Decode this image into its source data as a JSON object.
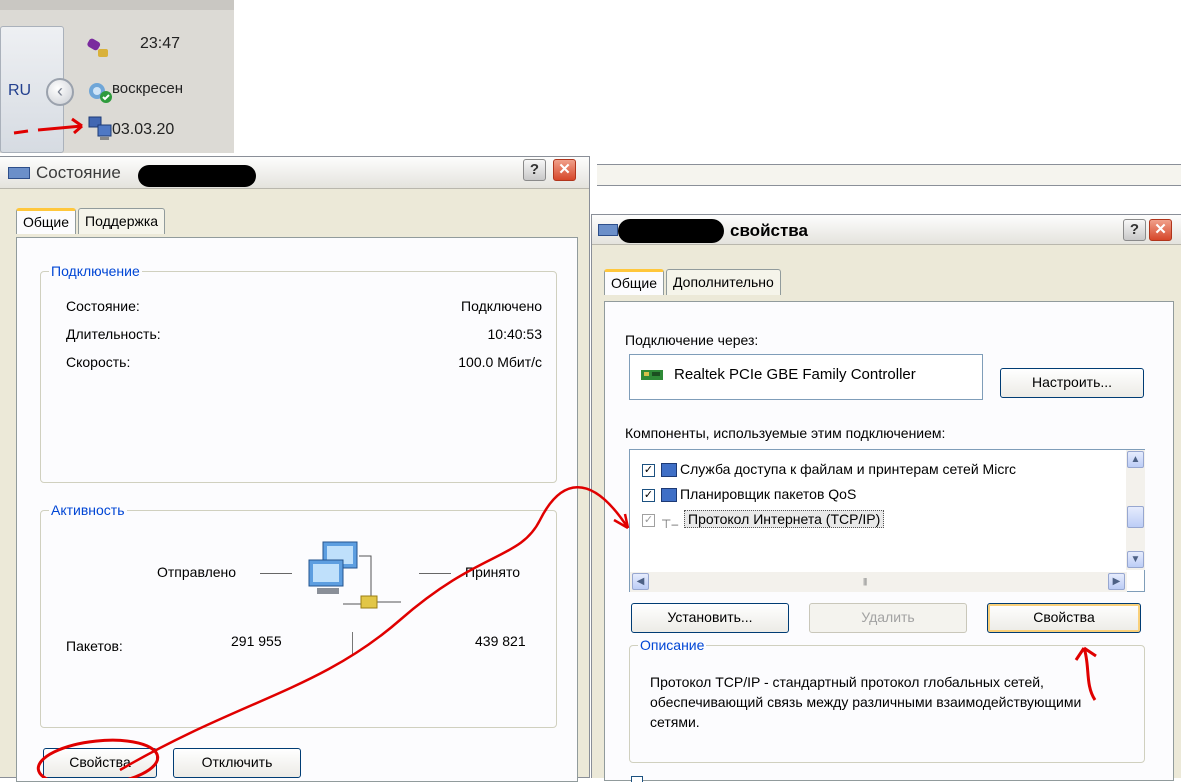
{
  "tray": {
    "time": "23:47",
    "day": "воскресен",
    "date": "03.03.20",
    "lang": "RU",
    "icons": [
      "power-tool-icon",
      "network-shield-icon",
      "network-connection-icon",
      "chevron-left-icon"
    ]
  },
  "status_window": {
    "title": "Состояние",
    "tabs": [
      "Общие",
      "Поддержка"
    ],
    "connection_group": {
      "legend": "Подключение",
      "rows": [
        {
          "label": "Состояние:",
          "value": "Подключено"
        },
        {
          "label": "Длительность:",
          "value": "10:40:53"
        },
        {
          "label": "Скорость:",
          "value": "100.0 Мбит/с"
        }
      ]
    },
    "activity_group": {
      "legend": "Активность",
      "sent_label": "Отправлено",
      "received_label": "Принято",
      "packets_label": "Пакетов:",
      "packets_sent": "291 955",
      "packets_received": "439 821"
    },
    "buttons": {
      "properties": "Свойства",
      "disable": "Отключить"
    }
  },
  "props_window": {
    "title": "свойства",
    "tabs": [
      "Общие",
      "Дополнительно"
    ],
    "connect_via_label": "Подключение через:",
    "adapter_name": "Realtek PCIe GBE Family Controller",
    "configure_button": "Настроить...",
    "components_label": "Компоненты, используемые этим подключением:",
    "components": [
      {
        "label": "Служба доступа к файлам и принтерам сетей Micrс",
        "checked": true,
        "selected": false,
        "icon": "network-service-icon"
      },
      {
        "label": "Планировщик пакетов QoS",
        "checked": true,
        "selected": false,
        "icon": "network-service-icon"
      },
      {
        "label": "Протокол Интернета (TCP/IP)",
        "checked": true,
        "selected": true,
        "icon": "protocol-icon"
      }
    ],
    "install_button": "Установить...",
    "remove_button": "Удалить",
    "properties_button": "Свойства",
    "description_legend": "Описание",
    "description_text": "Протокол TCP/IP - стандартный протокол глобальных сетей, обеспечивающий связь между различными взаимодействующими сетями.",
    "colors": {
      "accent": "#0046d5",
      "tab_highlight": "#ffc73c",
      "annotation": "#e00000"
    }
  }
}
